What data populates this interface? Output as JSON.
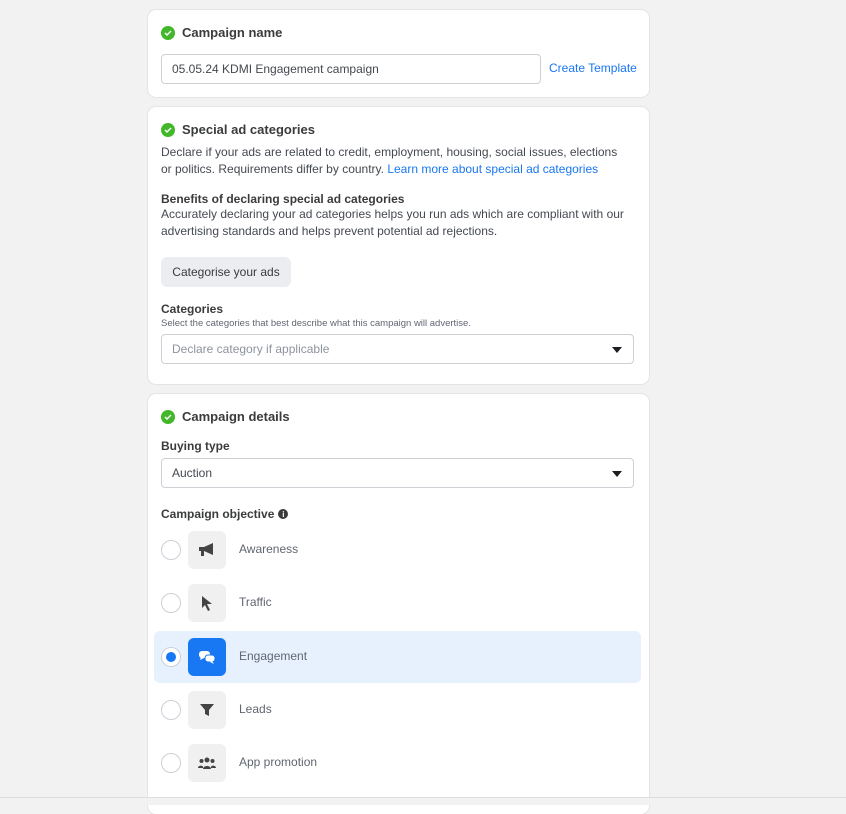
{
  "campaign_name": {
    "title": "Campaign name",
    "value": "05.05.24 KDMI Engagement campaign",
    "create_template": "Create Template"
  },
  "special": {
    "title": "Special ad categories",
    "desc": "Declare if your ads are related to credit, employment, housing, social issues, elections or politics. Requirements differ by country.",
    "learn_more": "Learn more about special ad categories",
    "benefits_title": "Benefits of declaring special ad categories",
    "benefits_desc": "Accurately declaring your ad categories helps you run ads which are compliant with our advertising standards and helps prevent potential ad rejections.",
    "categorise_button": "Categorise your ads",
    "categories_label": "Categories",
    "categories_help": "Select the categories that best describe what this campaign will advertise.",
    "categories_placeholder": "Declare category if applicable"
  },
  "details": {
    "title": "Campaign details",
    "buying_type_label": "Buying type",
    "buying_type_value": "Auction",
    "objective_label": "Campaign objective",
    "objectives": [
      {
        "label": "Awareness",
        "icon": "megaphone-icon",
        "selected": false
      },
      {
        "label": "Traffic",
        "icon": "cursor-icon",
        "selected": false
      },
      {
        "label": "Engagement",
        "icon": "chat-bubbles-icon",
        "selected": true
      },
      {
        "label": "Leads",
        "icon": "funnel-icon",
        "selected": false
      },
      {
        "label": "App promotion",
        "icon": "people-icon",
        "selected": false
      }
    ]
  },
  "colors": {
    "accent": "#1877f2",
    "success": "#42b72a",
    "selected_bg": "#e7f0fd"
  }
}
